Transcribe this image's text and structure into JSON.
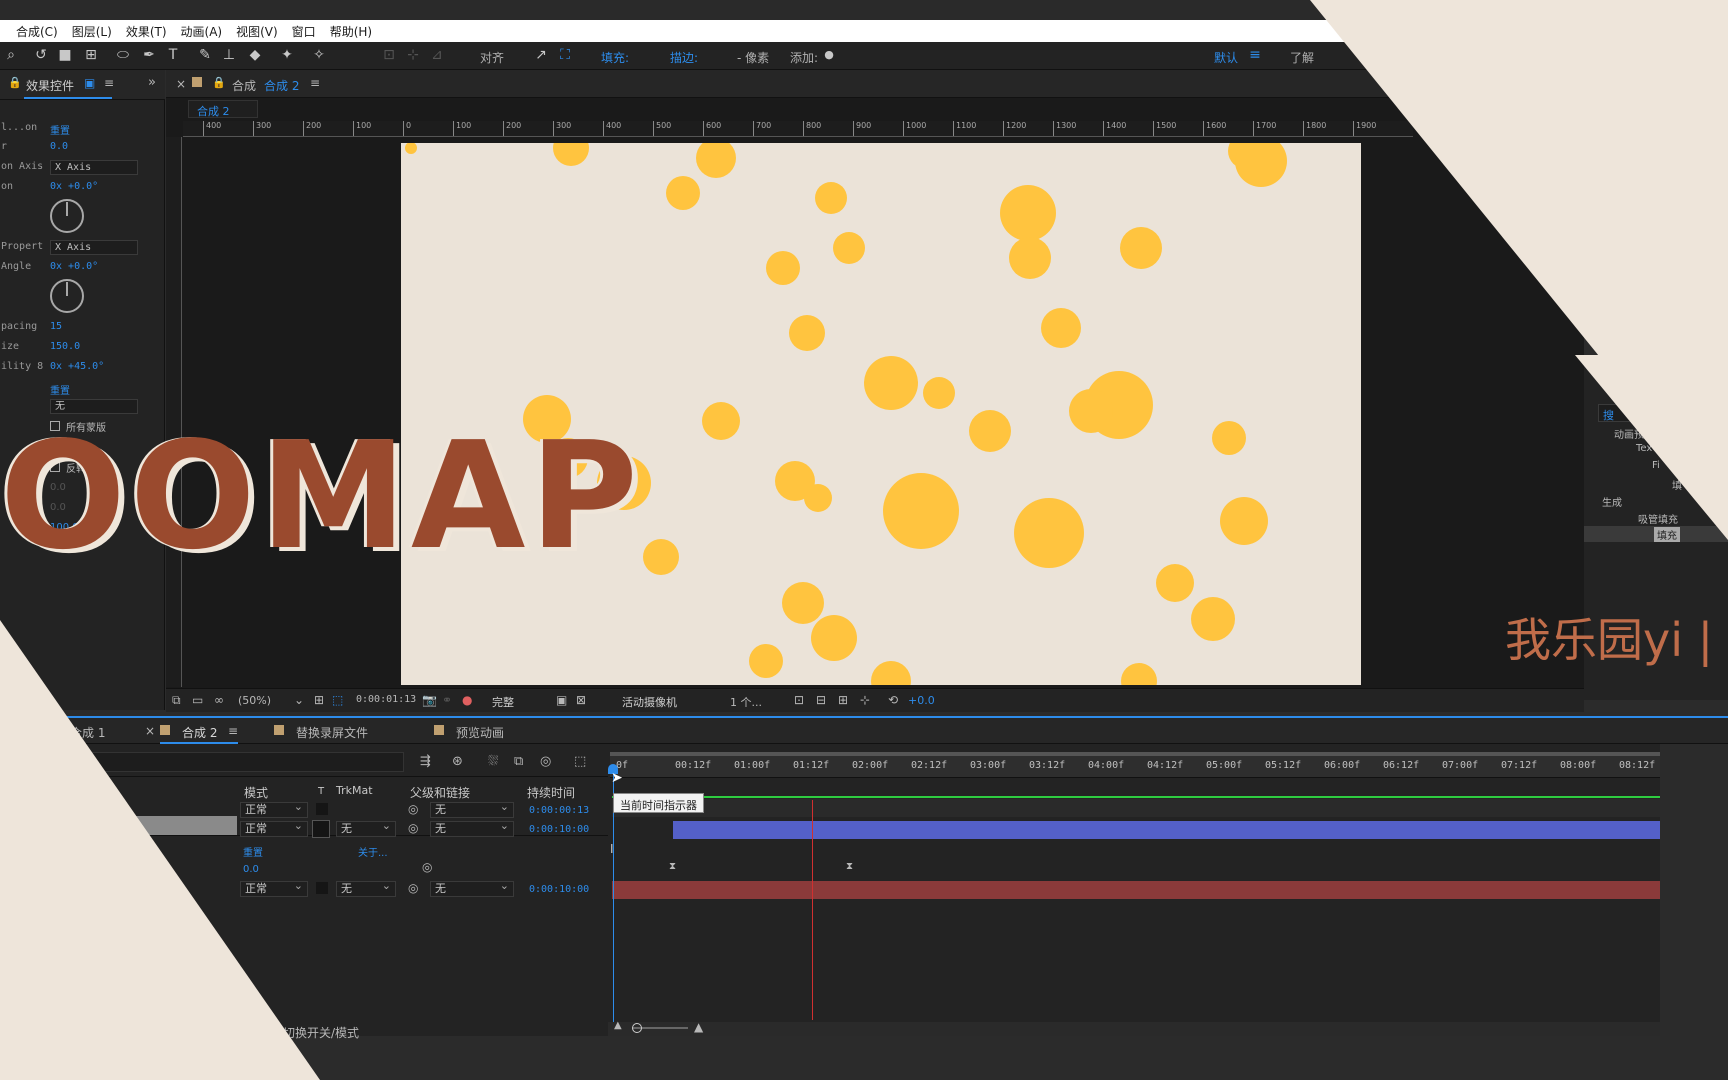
{
  "menu": [
    "合成(C)",
    "图层(L)",
    "效果(T)",
    "动画(A)",
    "视图(V)",
    "窗口",
    "帮助(H)"
  ],
  "toolbar": {
    "align_label": "对齐",
    "fill_label": "填充:",
    "stroke_label": "描边:",
    "pixels_label": "- 像素",
    "add_label": "添加:",
    "workspace_default": "默认",
    "learn": "了解",
    "fill_color": "#ffc43f",
    "stroke_color": "#c0392b"
  },
  "effects_panel": {
    "tab_label": "效果控件",
    "rows": [
      {
        "label": "l...on",
        "value": "重置"
      },
      {
        "label": "r",
        "value": "0.0"
      },
      {
        "label": "on Axis",
        "select": "X Axis"
      },
      {
        "label": "on",
        "value": "0x +0.0°"
      },
      {
        "label": "Propert",
        "select": "X Axis"
      },
      {
        "label": "Angle",
        "value": "0x +0.0°"
      },
      {
        "label": "pacing",
        "value": "15"
      },
      {
        "label": "ize",
        "value": "150.0"
      },
      {
        "label": "ility 8",
        "value": "0x +45.0°"
      }
    ],
    "reset_label": "重置",
    "none_option": "无",
    "all_masks": "所有蒙版",
    "invert": "反转",
    "dim_value_1": "0.0",
    "dim_value_2": "0.0",
    "percent": "100.0%"
  },
  "viewer": {
    "close_glyph": "×",
    "comp_label": "合成",
    "comp_name": "合成 2",
    "breadcrumb": "合成 2",
    "ruler_marks": [
      "400",
      "300",
      "200",
      "100",
      "0",
      "100",
      "200",
      "300",
      "400",
      "500",
      "600",
      "700",
      "800",
      "900",
      "1000",
      "1100",
      "1200",
      "1300",
      "1400",
      "1500",
      "1600",
      "1700",
      "1800",
      "1900"
    ],
    "zoom": "(50%)",
    "timecode": "0:00:01:13",
    "resolution": "完整",
    "camera": "活动摄像机",
    "views": "1 个...",
    "exposure": "+0.0"
  },
  "right_panel": {
    "search_hint": "搜",
    "items": [
      "动画预",
      "Tex",
      "Fi",
      "填",
      "生成",
      "吸管填充",
      "填充"
    ]
  },
  "brand": {
    "text": "OOMAP",
    "watermark": "我乐园yi | w"
  },
  "timeline": {
    "tabs": [
      "合成 1",
      "合成 2",
      "替换录屏文件",
      "预览动画"
    ],
    "ticks": [
      "0f",
      "00:12f",
      "01:00f",
      "01:12f",
      "02:00f",
      "02:12f",
      "03:00f",
      "03:12f",
      "04:00f",
      "04:12f",
      "05:00f",
      "05:12f",
      "06:00f",
      "06:12f",
      "07:00f",
      "07:12f",
      "08:00f",
      "08:12f"
    ],
    "headers": {
      "mode": "模式",
      "t": "T",
      "trkmat": "TrkMat",
      "parent": "父级和链接",
      "duration": "持续时间"
    },
    "rows": [
      {
        "mode": "正常",
        "trkmat": "",
        "parent": "无",
        "duration": "0:00:00:13"
      },
      {
        "mode": "正常",
        "trkmat": "无",
        "parent": "无",
        "duration": "0:00:10:00"
      },
      {
        "mode": "正常",
        "trkmat": "无",
        "parent": "无",
        "duration": "0:00:10:00"
      }
    ],
    "sub_reset": "重置",
    "sub_about": "关于...",
    "sub_value": "0.0",
    "tooltip": "当前时间指示器",
    "footer_toggle": "切换开关/模式"
  }
}
